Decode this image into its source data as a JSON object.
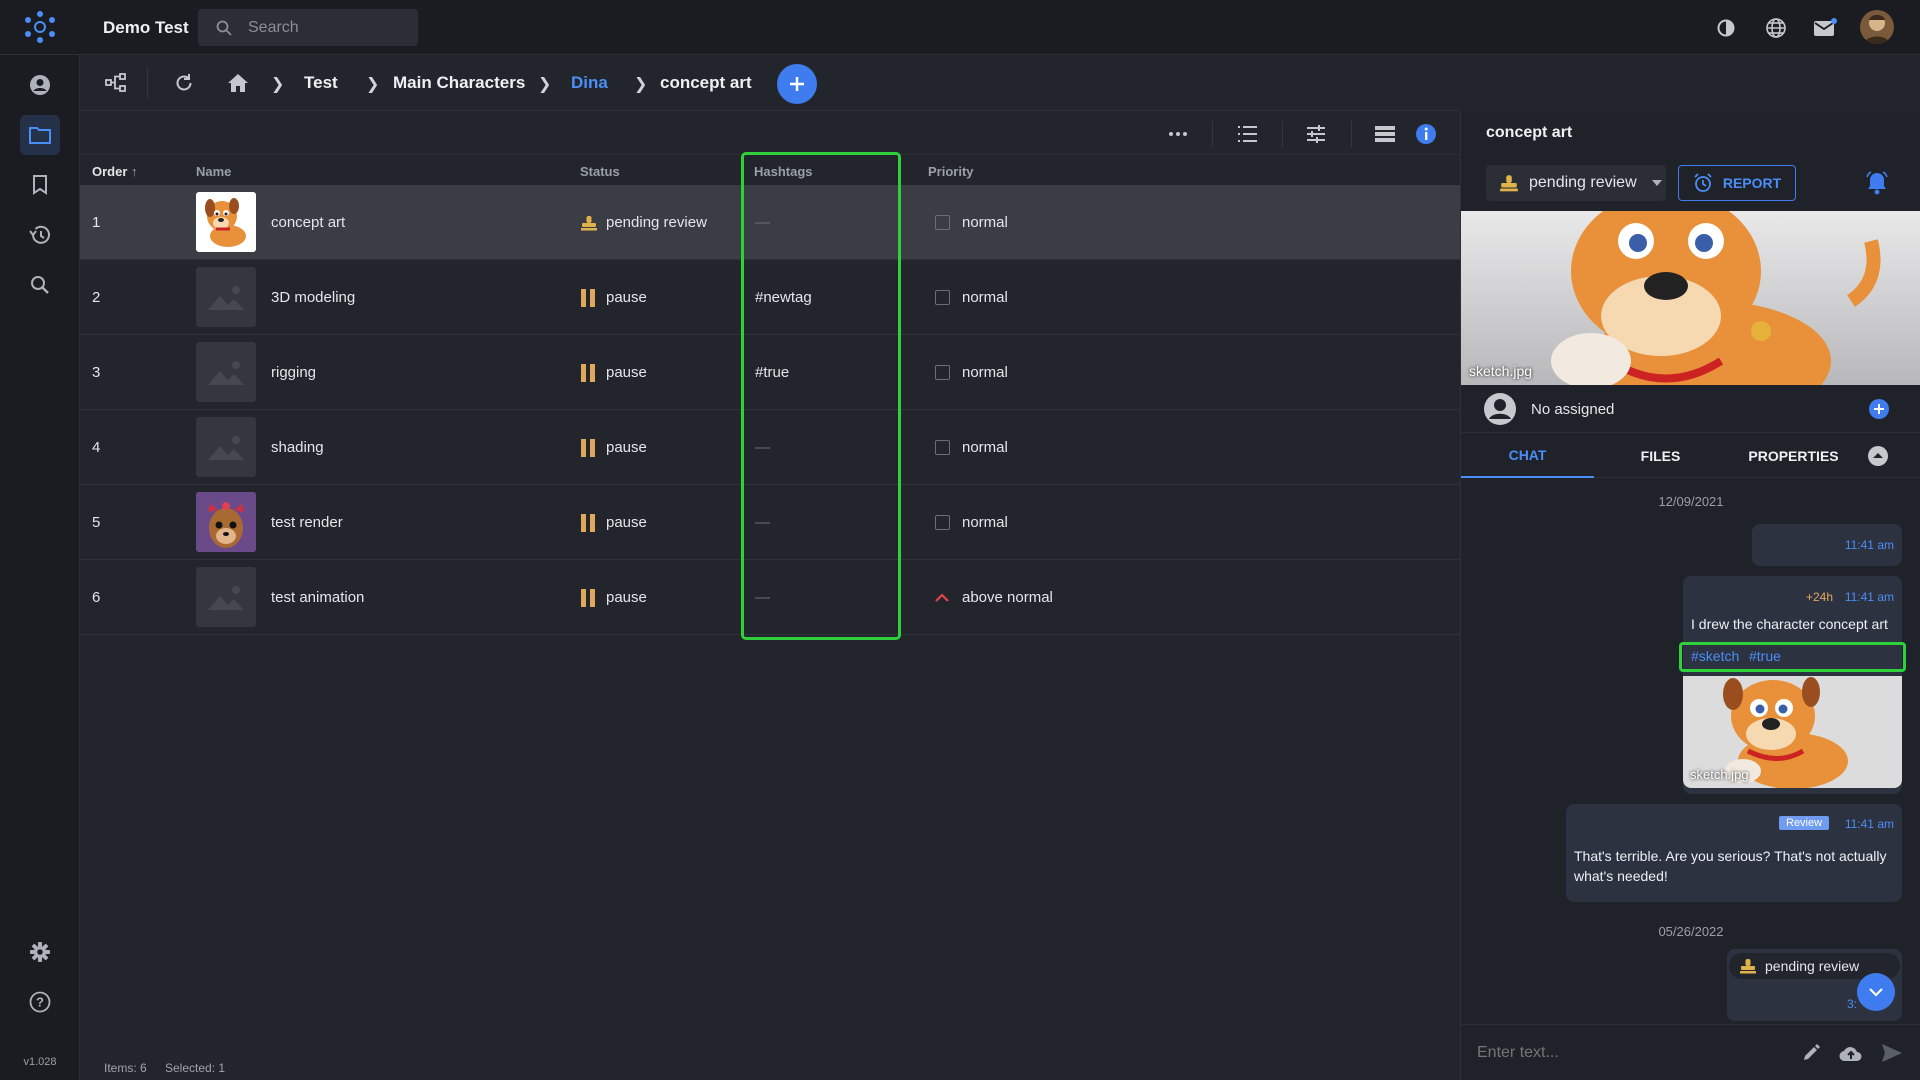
{
  "app": {
    "project_name": "Demo Test",
    "search_placeholder": "Search",
    "version": "v1.028"
  },
  "breadcrumb": [
    "Test",
    "Main Characters",
    "Dina",
    "concept art"
  ],
  "table": {
    "headers": {
      "order": "Order",
      "name": "Name",
      "status": "Status",
      "hashtags": "Hashtags",
      "priority": "Priority"
    },
    "rows": [
      {
        "order": "1",
        "name": "concept art",
        "status": "pending review",
        "hashtag": "—",
        "priority": "normal"
      },
      {
        "order": "2",
        "name": "3D modeling",
        "status": "pause",
        "hashtag": "#newtag",
        "priority": "normal"
      },
      {
        "order": "3",
        "name": "rigging",
        "status": "pause",
        "hashtag": "#true",
        "priority": "normal"
      },
      {
        "order": "4",
        "name": "shading",
        "status": "pause",
        "hashtag": "—",
        "priority": "normal"
      },
      {
        "order": "5",
        "name": "test render",
        "status": "pause",
        "hashtag": "—",
        "priority": "normal"
      },
      {
        "order": "6",
        "name": "test animation",
        "status": "pause",
        "hashtag": "—",
        "priority": "above normal"
      }
    ]
  },
  "footer": {
    "items": "Items: 6",
    "selected": "Selected: 1"
  },
  "panel": {
    "title": "concept art",
    "status": "pending review",
    "report_label": "REPORT",
    "preview_label": "sketch.jpg",
    "assignee": "No assigned",
    "tabs": [
      "CHAT",
      "FILES",
      "PROPERTIES"
    ],
    "chat": {
      "date1": "12/09/2021",
      "msg1_time": "11:41 am",
      "msg2_badge": "+24h",
      "msg2_time": "11:41 am",
      "msg2_text": "I drew the character concept art",
      "msg2_tags": [
        "#sketch",
        "#true"
      ],
      "msg2_image_label": "sketch.jpg",
      "msg3_badge": "Review",
      "msg3_time": "11:41 am",
      "msg3_text": "That's terrible. Are you serious? That's not actually what's needed!",
      "date2": "05/26/2022",
      "msg4_status": "pending review",
      "msg4_time": "3:"
    },
    "composer_placeholder": "Enter text..."
  },
  "colors": {
    "accent": "#3f7cf0",
    "highlight": "#2fd13a",
    "pause": "#e0a85a",
    "priority_up": "#e0454b"
  }
}
